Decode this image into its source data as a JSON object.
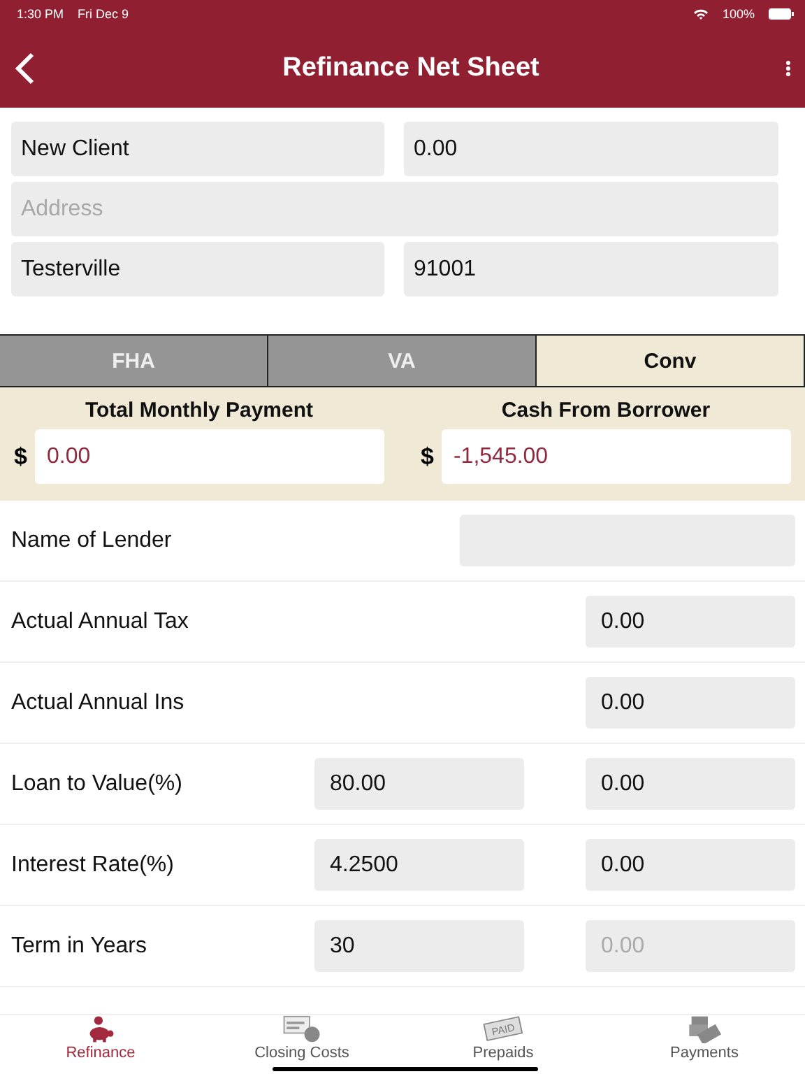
{
  "status_bar": {
    "time": "1:30 PM",
    "date": "Fri Dec 9",
    "battery": "100%"
  },
  "header": {
    "title": "Refinance Net Sheet"
  },
  "client": [
    {
      "kind": "half",
      "value": "New Client"
    },
    {
      "kind": "half",
      "value": "0.00"
    },
    {
      "kind": "wide",
      "placeholder": "Address"
    },
    {
      "kind": "half",
      "value": "Testerville"
    },
    {
      "kind": "half",
      "value": "91001"
    }
  ],
  "loan_tabs": [
    {
      "label": "FHA",
      "selected": false
    },
    {
      "label": "VA",
      "selected": false
    },
    {
      "label": "Conv",
      "selected": true
    }
  ],
  "summary": [
    {
      "label": "Total Monthly Payment",
      "currency": "$",
      "value": "0.00"
    },
    {
      "label": "Cash From Borrower",
      "currency": "$",
      "value": "-1,545.00"
    }
  ],
  "rows": [
    {
      "kind": "wide",
      "label": "Name of Lender"
    },
    {
      "kind": "single",
      "label": "Actual Annual Tax",
      "value": "0.00"
    },
    {
      "kind": "single",
      "label": "Actual Annual Ins",
      "value": "0.00"
    },
    {
      "kind": "double",
      "label": "Loan to Value(%)",
      "input": "80.00",
      "value": "0.00"
    },
    {
      "kind": "double",
      "label": "Interest Rate(%)",
      "input": "4.2500",
      "value": "0.00"
    },
    {
      "kind": "double",
      "label": "Term in Years",
      "input": "30",
      "placeholder": "0.00"
    }
  ],
  "tab_bar": [
    {
      "label": "Refinance",
      "selected": true
    },
    {
      "label": "Closing Costs",
      "selected": false
    },
    {
      "label": "Prepaids",
      "badge_text": "PAID",
      "selected": false
    },
    {
      "label": "Payments",
      "selected": false
    }
  ]
}
